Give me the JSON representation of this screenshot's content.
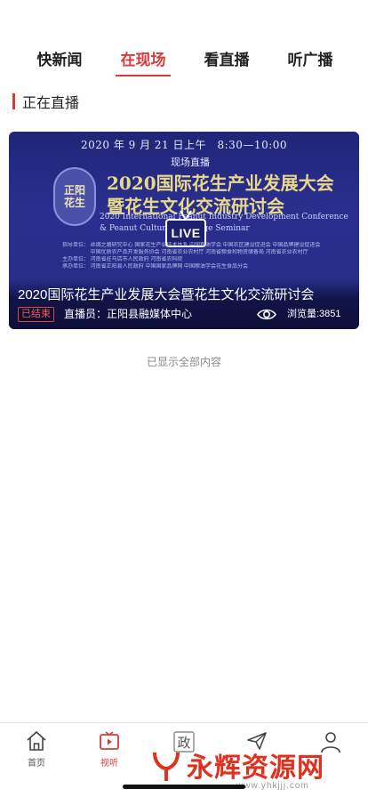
{
  "tabs": [
    {
      "label": "快新闻"
    },
    {
      "label": "在现场"
    },
    {
      "label": "看直播"
    },
    {
      "label": "听广播"
    }
  ],
  "section": {
    "title": "正在直播"
  },
  "live_card": {
    "poster_date": "2020 年 9 月 21 日上午　8:30—10:00",
    "poster_subtitle": "现场直播",
    "poster_logo_top": "正阳",
    "poster_logo_bottom": "花生",
    "poster_title_line1": "2020国际花生产业发展大会",
    "poster_title_line2": "暨花生文化交流研讨会",
    "poster_en_line1": "2020 International Peanut Industry Development Conference",
    "poster_en_line2": "& Peanut Culture Exchange Seminar",
    "live_badge": "LIVE",
    "org_lines": [
      "指导单位：  丝绸之路研究中心   国家花生产业技术体系   中国粮油学会   中国农区建设促进会   中国品牌建设促进会",
      "　　　　　  中国优质农产品开发服务协会   河南省农业农村厅   河南省粮食和物资储备局   河南省农业农村厅",
      "主办单位：  河南省驻马店市人民政府   河南省农科院",
      "承办单位：  河南省正阳县人民政府   中国国家品牌网   中国粮油学会花生食品分会"
    ],
    "name": "2020国际花生产业发展大会暨花生文化交流研讨会",
    "status": "已结束",
    "broadcaster": "直播员：正阳县融媒体中心",
    "views": "浏览量:3851"
  },
  "footer_text": "已显示全部内容",
  "bottom_nav": [
    {
      "label": "首页",
      "icon": "home-icon"
    },
    {
      "label": "视听",
      "icon": "video-icon"
    },
    {
      "label": "",
      "icon": "politics-icon",
      "glyph": "政"
    },
    {
      "label": "",
      "icon": "send-icon"
    },
    {
      "label": "",
      "icon": "user-icon"
    }
  ],
  "watermark": {
    "text": "永辉资源网",
    "url": "www.yhkjjj.com"
  },
  "colors": {
    "accent": "#d93a3a",
    "card_bg": "#262b82",
    "title_gold": "#e8d98a"
  }
}
